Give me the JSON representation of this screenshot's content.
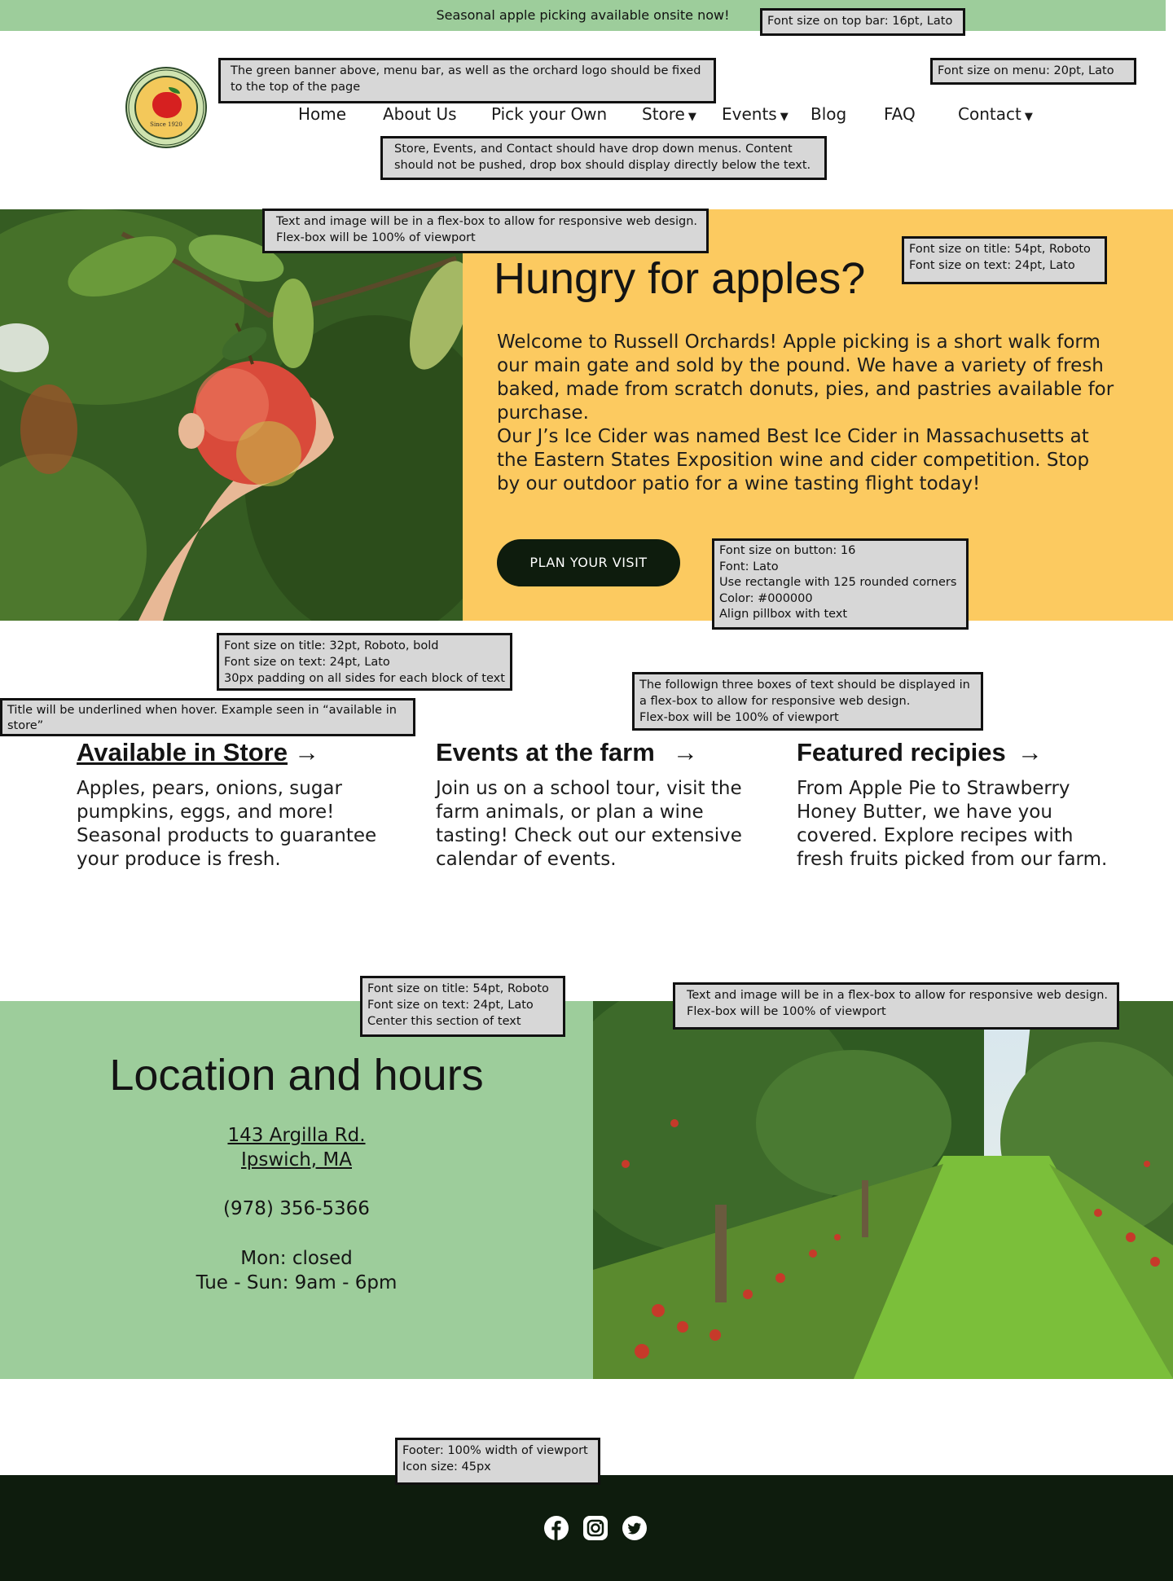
{
  "topbar": {
    "text": "Seasonal apple picking available onsite now!"
  },
  "notes": {
    "topbar_font": "Font size on top bar: 16pt, Lato",
    "fixed": "The green banner above, menu bar, as well as the orchard logo should be fixed to the top of the page",
    "menu_font": "Font size on menu: 20pt, Lato",
    "dropdowns": "Store, Events, and Contact should have drop down menus. Content should not be pushed, drop box should display directly below the text.",
    "hero_flex": "Text and image will be in a flex-box to allow for responsive web design. Flex-box will be 100% of viewport",
    "hero_font": "Font size on title: 54pt, Roboto\nFont size on text: 24pt, Lato",
    "button": "Font size on button: 16\nFont: Lato\nUse rectangle with 125 rounded corners\nColor: #000000\nAlign pillbox with text",
    "cards_font": "Font size on title: 32pt, Roboto, bold\nFont size on text: 24pt, Lato\n30px padding on all sides for each block of text",
    "underline": "Title will be underlined when hover. Example seen in “available in store”",
    "cards_flex": "The followign three boxes of text should be displayed in a flex-box to allow for responsive web design.\nFlex-box will be 100% of viewport",
    "loc_font": "Font size on title: 54pt, Roboto\nFont size on text: 24pt, Lato\nCenter this section of text",
    "loc_flex": "Text and image will be in a flex-box to allow for responsive web design. Flex-box will be 100% of viewport",
    "footer": "Footer: 100% width of viewport\nIcon size: 45px"
  },
  "logo": {
    "since": "Since 1920"
  },
  "menu": {
    "home": "Home",
    "about": "About Us",
    "pick": "Pick your Own",
    "store": "Store",
    "events": "Events",
    "blog": "Blog",
    "faq": "FAQ",
    "contact": "Contact"
  },
  "hero": {
    "title": "Hungry for apples?",
    "p1": "Welcome to Russell Orchards! Apple picking is a short walk form our main gate and sold by the pound. We have a variety of fresh baked, made from scratch donuts, pies, and pastries available for purchase.",
    "p2": "Our J’s Ice Cider was named Best Ice Cider in Massachusetts at the Eastern States Exposition wine and cider competition. Stop by our outdoor patio for a wine tasting flight today!",
    "button": "PLAN YOUR VISIT"
  },
  "cards": [
    {
      "title": "Available in Store",
      "text": "Apples, pears, onions, sugar pumpkins, eggs, and more! Seasonal products to guarantee your produce is fresh."
    },
    {
      "title": "Events at the farm",
      "text": "Join us on a school tour, visit the farm animals, or plan a wine tasting! Check out our extensive calendar of events."
    },
    {
      "title": "Featured recipies",
      "text": "From Apple Pie to Strawberry Honey Butter, we have you covered. Explore recipes with fresh fruits picked from our farm."
    }
  ],
  "location": {
    "title": "Location and hours",
    "address1": "143 Argilla Rd.",
    "address2": "Ipswich, MA",
    "phone": "(978) 356-5366",
    "hours1": "Mon: closed",
    "hours2": "Tue - Sun: 9am - 6pm"
  },
  "colors": {
    "green": "#9dcd9b",
    "yellow": "#fcca60",
    "dark": "#0e1c0d"
  },
  "icons": {
    "facebook": "facebook-icon",
    "instagram": "instagram-icon",
    "twitter": "twitter-icon"
  }
}
